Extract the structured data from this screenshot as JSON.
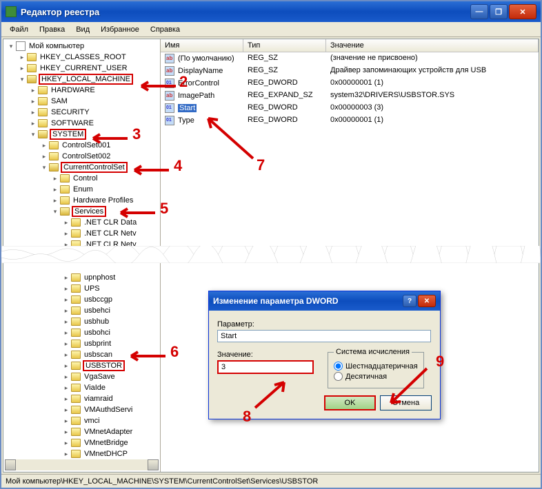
{
  "window": {
    "title": "Редактор реестра"
  },
  "menu": [
    "Файл",
    "Правка",
    "Вид",
    "Избранное",
    "Справка"
  ],
  "columns": {
    "name": "Имя",
    "type": "Тип",
    "value": "Значение"
  },
  "values": [
    {
      "icon": "sz",
      "name": "(По умолчанию)",
      "type": "REG_SZ",
      "value": "(значение не присвоено)"
    },
    {
      "icon": "sz",
      "name": "DisplayName",
      "type": "REG_SZ",
      "value": "Драйвер запоминающих устройств для USB"
    },
    {
      "icon": "dw",
      "name": "ErrorControl",
      "type": "REG_DWORD",
      "value": "0x00000001 (1)"
    },
    {
      "icon": "sz",
      "name": "ImagePath",
      "type": "REG_EXPAND_SZ",
      "value": "system32\\DRIVERS\\USBSTOR.SYS"
    },
    {
      "icon": "dw",
      "name": "Start",
      "type": "REG_DWORD",
      "value": "0x00000003 (3)",
      "selected": true
    },
    {
      "icon": "dw",
      "name": "Type",
      "type": "REG_DWORD",
      "value": "0x00000001 (1)"
    }
  ],
  "tree_top": [
    {
      "d": 0,
      "i": "pc",
      "l": "Мой компьютер",
      "open": true
    },
    {
      "d": 1,
      "l": "HKEY_CLASSES_ROOT"
    },
    {
      "d": 1,
      "l": "HKEY_CURRENT_USER"
    },
    {
      "d": 1,
      "l": "HKEY_LOCAL_MACHINE",
      "open": true,
      "hl": true
    },
    {
      "d": 2,
      "l": "HARDWARE"
    },
    {
      "d": 2,
      "l": "SAM"
    },
    {
      "d": 2,
      "l": "SECURITY"
    },
    {
      "d": 2,
      "l": "SOFTWARE"
    },
    {
      "d": 2,
      "l": "SYSTEM",
      "open": true,
      "hl": true
    },
    {
      "d": 3,
      "l": "ControlSet001"
    },
    {
      "d": 3,
      "l": "ControlSet002"
    },
    {
      "d": 3,
      "l": "CurrentControlSet",
      "open": true,
      "hl": true
    },
    {
      "d": 4,
      "l": "Control"
    },
    {
      "d": 4,
      "l": "Enum"
    },
    {
      "d": 4,
      "l": "Hardware Profiles"
    },
    {
      "d": 4,
      "l": "Services",
      "open": true,
      "hl": true
    },
    {
      "d": 5,
      "l": ".NET CLR Data"
    },
    {
      "d": 5,
      "l": ".NET CLR Netv"
    },
    {
      "d": 5,
      "l": ".NET CLR Netv"
    }
  ],
  "tree_bottom": [
    {
      "d": 5,
      "l": "upnphost"
    },
    {
      "d": 5,
      "l": "UPS"
    },
    {
      "d": 5,
      "l": "usbccgp"
    },
    {
      "d": 5,
      "l": "usbehci"
    },
    {
      "d": 5,
      "l": "usbhub"
    },
    {
      "d": 5,
      "l": "usbohci"
    },
    {
      "d": 5,
      "l": "usbprint"
    },
    {
      "d": 5,
      "l": "usbscan"
    },
    {
      "d": 5,
      "l": "USBSTOR",
      "hl": true
    },
    {
      "d": 5,
      "l": "VgaSave"
    },
    {
      "d": 5,
      "l": "ViaIde"
    },
    {
      "d": 5,
      "l": "viamraid"
    },
    {
      "d": 5,
      "l": "VMAuthdServi"
    },
    {
      "d": 5,
      "l": "vmci"
    },
    {
      "d": 5,
      "l": "VMnetAdapter"
    },
    {
      "d": 5,
      "l": "VMnetBridge"
    },
    {
      "d": 5,
      "l": "VMnetDHCP"
    }
  ],
  "dialog": {
    "title": "Изменение параметра DWORD",
    "param_label": "Параметр:",
    "param_value": "Start",
    "value_label": "Значение:",
    "value_input": "3",
    "base_label": "Система исчисления",
    "hex": "Шестнадцатеричная",
    "dec": "Десятичная",
    "ok": "OK",
    "cancel": "Отмена"
  },
  "status": "Мой компьютер\\HKEY_LOCAL_MACHINE\\SYSTEM\\CurrentControlSet\\Services\\USBSTOR",
  "annotations": {
    "a2": "2",
    "a3": "3",
    "a4": "4",
    "a5": "5",
    "a6": "6",
    "a7": "7",
    "a8": "8",
    "a9": "9"
  }
}
